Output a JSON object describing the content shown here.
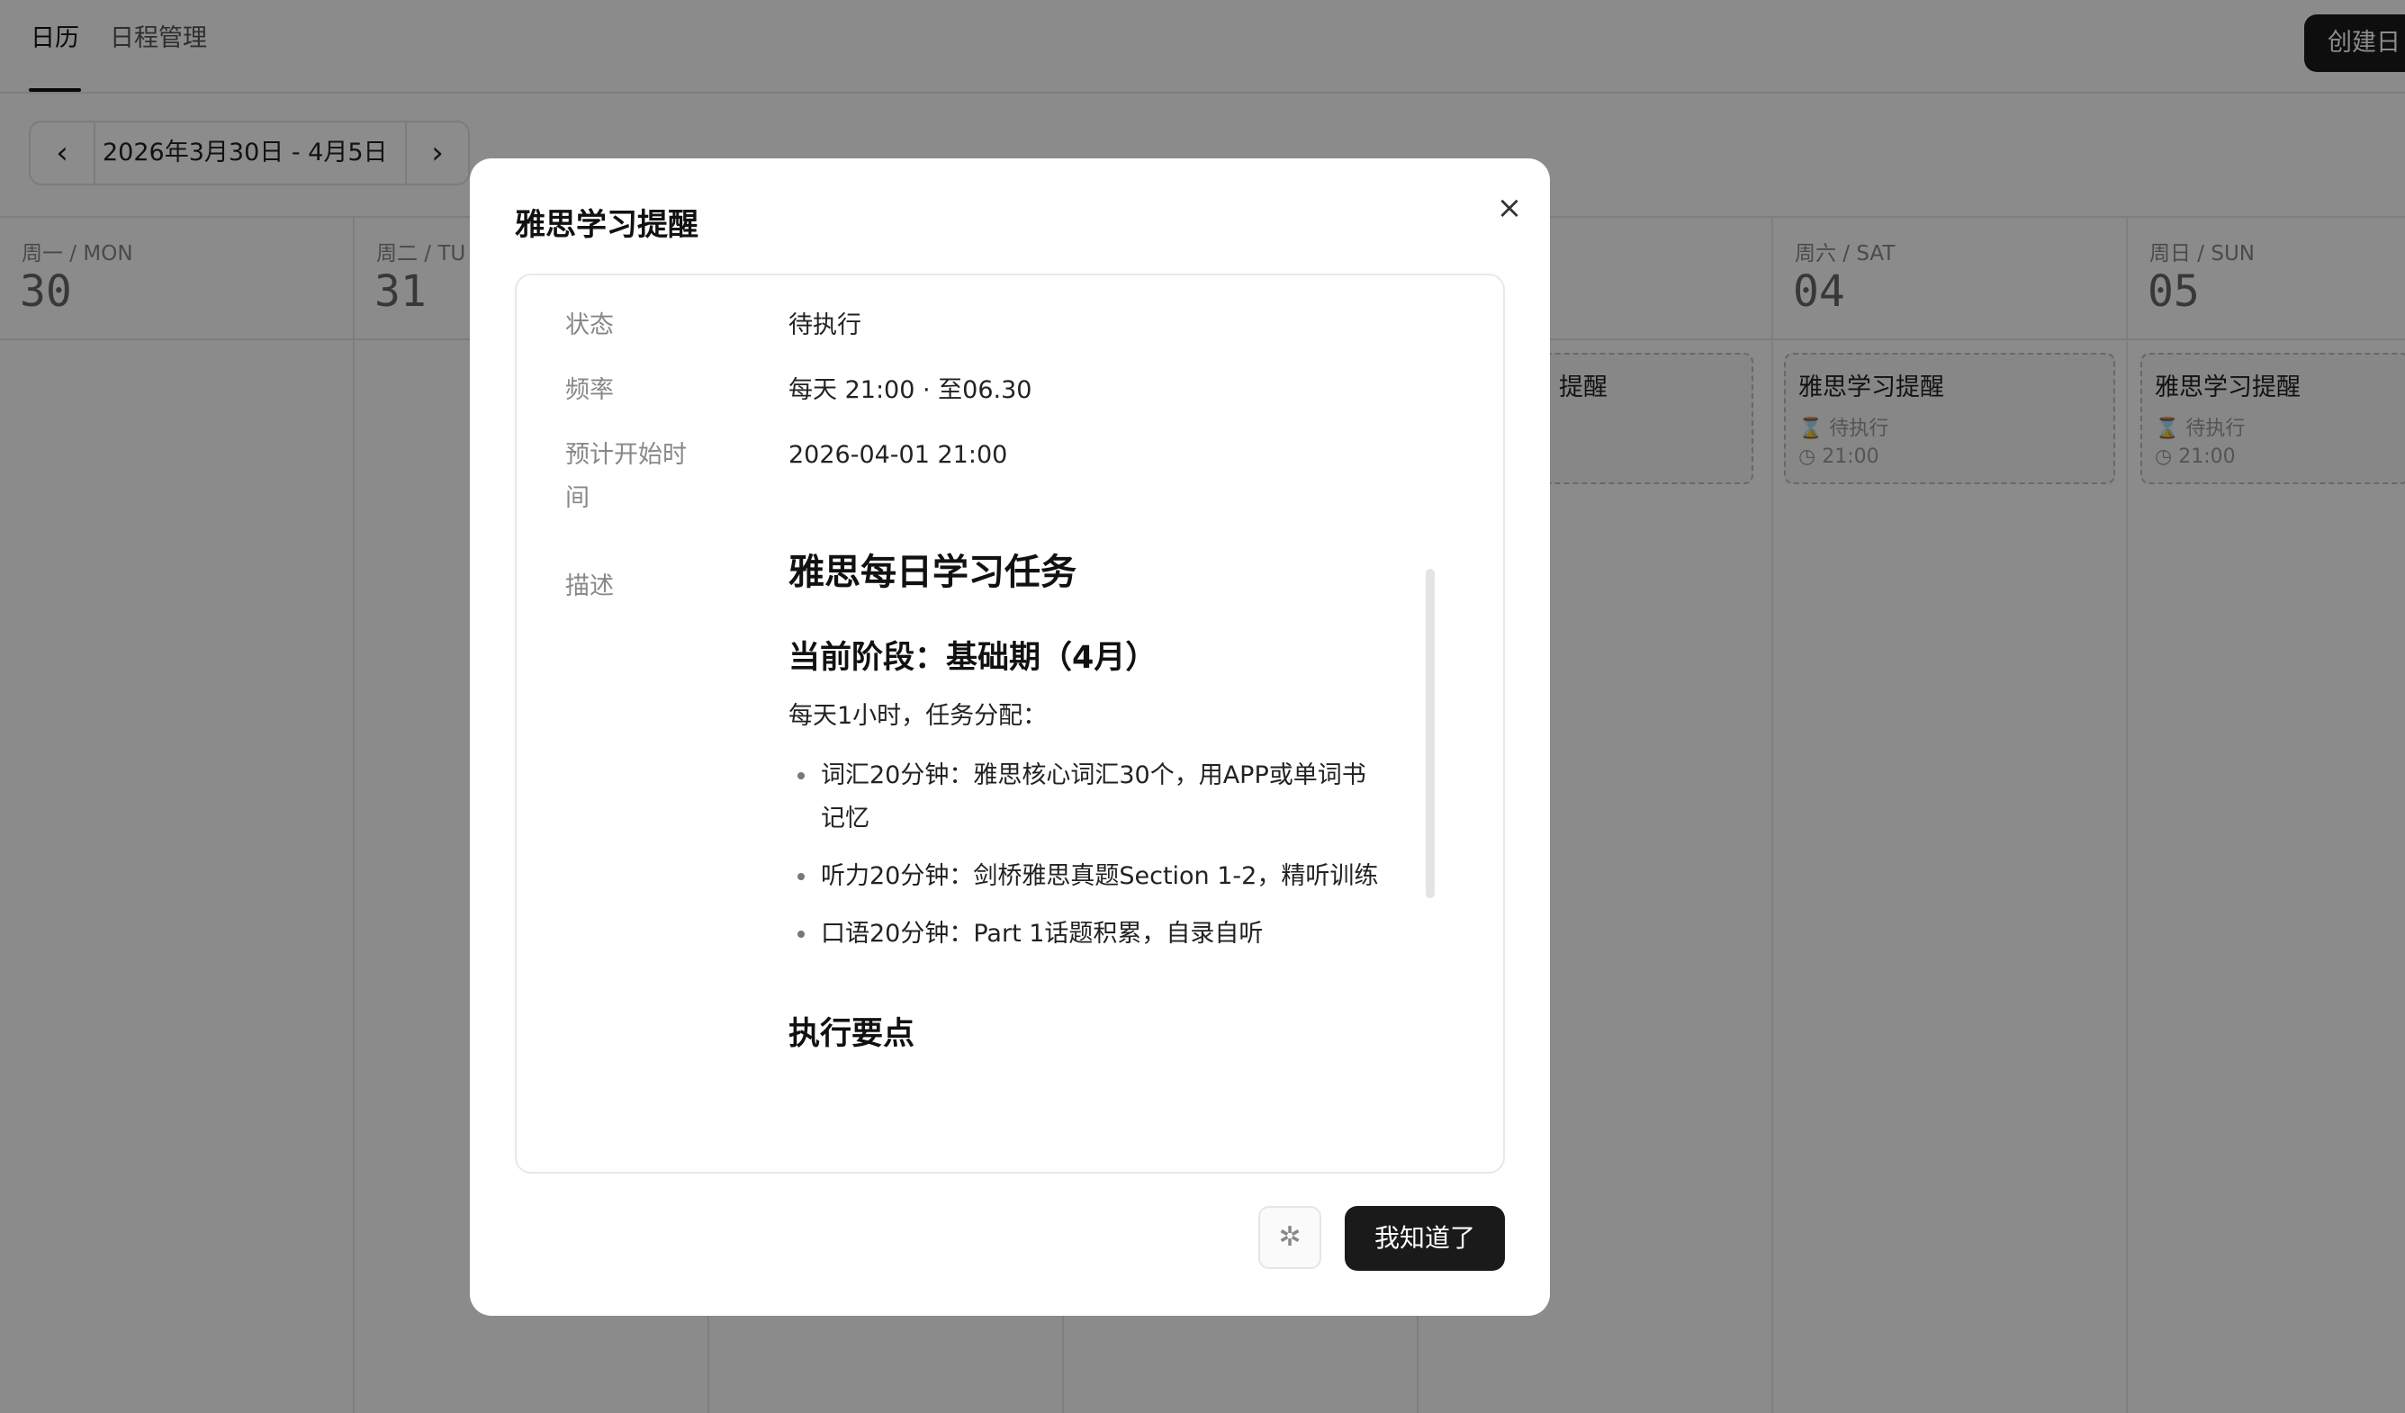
{
  "nav": {
    "tabs": [
      {
        "label": "日历",
        "active": true
      },
      {
        "label": "日程管理",
        "active": false
      }
    ],
    "create_button": "创建日"
  },
  "week": {
    "prev_icon": "chevron-left-icon",
    "range": "2026年3月30日 - 4月5日",
    "next_icon": "chevron-right-icon"
  },
  "days": [
    {
      "name": "周一 / MON",
      "num": "30"
    },
    {
      "name": "周二 / TU",
      "num": "31"
    },
    {
      "name": "",
      "num": ""
    },
    {
      "name": "",
      "num": ""
    },
    {
      "name": "",
      "num": ""
    },
    {
      "name": "周六 / SAT",
      "num": "04"
    },
    {
      "name": "周日 / SUN",
      "num": "05"
    }
  ],
  "events": [
    {
      "title": "提醒",
      "status": "",
      "time": ""
    },
    {
      "title": "雅思学习提醒",
      "status": "待执行",
      "time": "21:00"
    },
    {
      "title": "雅思学习提醒",
      "status": "待执行",
      "time": "21:00"
    }
  ],
  "modal": {
    "title": "雅思学习提醒",
    "close_icon": "close-icon",
    "fields": {
      "status_label": "状态",
      "status_value": "待执行",
      "freq_label": "频率",
      "freq_value": "每天 21:00 · 至06.30",
      "start_label_1": "预计开始时",
      "start_label_2": "间",
      "start_value": "2026-04-01 21:00",
      "desc_label": "描述"
    },
    "description": {
      "h1": "雅思每日学习任务",
      "h2": "当前阶段：基础期（4月）",
      "intro": "每天1小时，任务分配：",
      "items": [
        {
          "line1": "词汇20分钟：雅思核心词汇30个，用APP或单词书",
          "line2": "记忆"
        },
        {
          "line1": "听力20分钟：剑桥雅思真题Section 1-2，精听训练",
          "line2": ""
        },
        {
          "line1": "口语20分钟：Part 1话题积累，自录自听",
          "line2": ""
        }
      ],
      "h3": "执行要点"
    },
    "bug_icon": "bug-icon",
    "ok_button": "我知道了"
  }
}
